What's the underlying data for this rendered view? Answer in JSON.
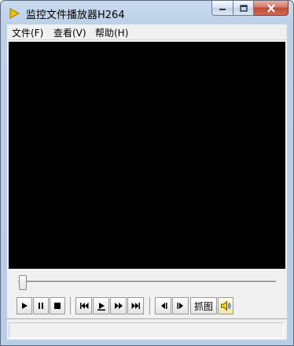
{
  "window": {
    "title": "监控文件播放器H264"
  },
  "menu": [
    "文件(F)",
    "查看(V)",
    "帮助(H)"
  ],
  "controls": {
    "play": "play-icon",
    "pause": "pause-icon",
    "stop": "stop-icon",
    "prev": "skip-previous-icon",
    "step": "step-play-icon",
    "fast": "fast-forward-icon",
    "next": "skip-next-icon",
    "frame_back": "frame-back-icon",
    "frame_fwd": "frame-forward-icon",
    "capture_label": "抓图",
    "volume": "speaker-icon"
  },
  "playback": {
    "progress": 0.0
  },
  "colors": {
    "video_bg": "#000000",
    "close_button": "#c24b36"
  }
}
